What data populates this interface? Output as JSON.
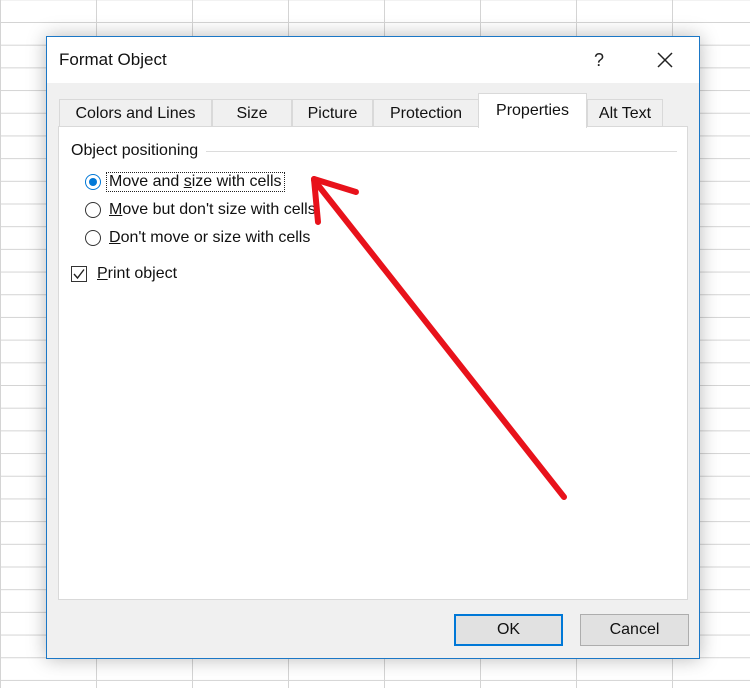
{
  "dialog": {
    "title": "Format Object",
    "help_label": "?",
    "close_icon": "close-icon"
  },
  "tabs": [
    {
      "label": "Colors and Lines",
      "active": false
    },
    {
      "label": "Size",
      "active": false
    },
    {
      "label": "Picture",
      "active": false
    },
    {
      "label": "Protection",
      "active": false
    },
    {
      "label": "Properties",
      "active": true
    },
    {
      "label": "Alt Text",
      "active": false
    }
  ],
  "properties": {
    "group_label": "Object positioning",
    "options": [
      {
        "pre": "Move and ",
        "accel": "s",
        "post": "ize with cells",
        "checked": true
      },
      {
        "pre": "",
        "accel": "M",
        "post": "ove but don't size with cells",
        "checked": false
      },
      {
        "pre": "",
        "accel": "D",
        "post": "on't move or size with cells",
        "checked": false
      }
    ],
    "print_object": {
      "pre": "",
      "accel": "P",
      "post": "rint object",
      "checked": true
    }
  },
  "buttons": {
    "ok": "OK",
    "cancel": "Cancel"
  },
  "annotation": {
    "type": "arrow",
    "color": "#e8121b"
  },
  "colors": {
    "accent": "#0078d7",
    "dialog_border": "#1b77c6"
  }
}
